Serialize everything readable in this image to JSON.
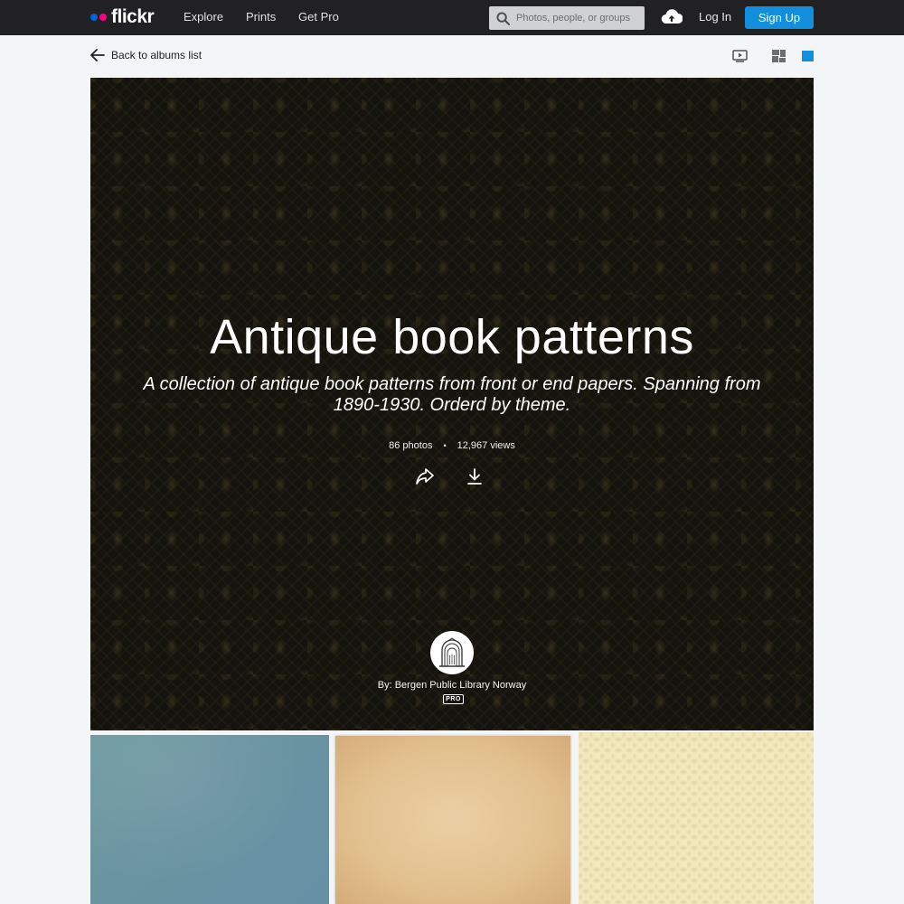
{
  "nav": {
    "logo_text": "flickr",
    "links": [
      "Explore",
      "Prints",
      "Get Pro"
    ],
    "search_placeholder": "Photos, people, or groups",
    "login_label": "Log In",
    "signup_label": "Sign Up"
  },
  "subbar": {
    "back_label": "Back to albums list"
  },
  "album": {
    "title": "Antique book patterns",
    "description": "A collection of antique book patterns from front or end papers. Spanning from 1890-1930. Orderd by theme.",
    "photo_count": "86 photos",
    "separator": "•",
    "views": "12,967 views",
    "owner_label": "By: Bergen Public Library Norway",
    "pro_badge": "PRO"
  },
  "colors": {
    "topbar_bg": "#212124",
    "signup_blue": "#128fdc",
    "logo_blue": "#0063dc",
    "logo_pink": "#ff0084",
    "page_bg": "#f3f5f6"
  },
  "icons": [
    "search-icon",
    "upload-cloud-icon",
    "back-arrow-icon",
    "slideshow-icon",
    "grid-view-icon",
    "single-view-icon",
    "share-icon",
    "download-icon",
    "library-logo-icon"
  ]
}
